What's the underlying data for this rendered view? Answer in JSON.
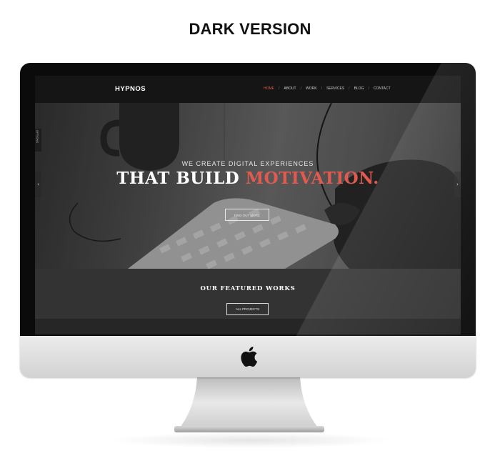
{
  "caption": "DARK VERSION",
  "site": {
    "logo": "HYPNOS",
    "menu": [
      {
        "label": "HOME",
        "active": true
      },
      {
        "label": "ABOUT",
        "active": false
      },
      {
        "label": "WORK",
        "active": false
      },
      {
        "label": "SERVICES",
        "active": false
      },
      {
        "label": "BLOG",
        "active": false
      },
      {
        "label": "CONTACT",
        "active": false
      }
    ],
    "menu_separator": "/",
    "options_tab": "OPTIONS",
    "hero": {
      "tagline": "WE CREATE DIGITAL EXPERIENCES",
      "headline_main": "THAT BUILD ",
      "headline_accent": "MOTIVATION.",
      "cta_label": "FIND OUT MORE"
    },
    "slider_prev": "‹",
    "slider_next": "›",
    "featured": {
      "title": "OUR FEATURED WORKS",
      "button_label": "ALL PROJECTS"
    }
  },
  "colors": {
    "accent": "#e05a4f",
    "nav_bg": "#151515",
    "section_bg": "#333333"
  },
  "icons": {
    "monitor_logo": "apple-logo-icon",
    "prev": "chevron-left-icon",
    "next": "chevron-right-icon"
  }
}
